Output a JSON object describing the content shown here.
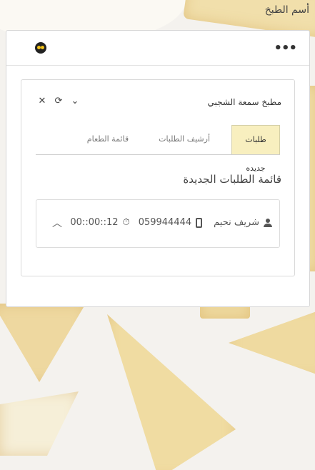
{
  "header": {
    "title": "أسم الطبخ"
  },
  "panel": {
    "menu_icon": "more-dots-icon",
    "logo_icon": "eyes-logo-icon"
  },
  "card": {
    "kitchen_name": "مطبخ سمعة الشجبي",
    "icons": [
      "close-icon",
      "refresh-icon",
      "chevron-down-icon"
    ]
  },
  "tabs": [
    {
      "label": "طلبات جديده",
      "active": true
    },
    {
      "label": "أرشيف الطلبات",
      "active": false
    },
    {
      "label": "قائمة الطعام",
      "active": false
    }
  ],
  "section": {
    "title": "قائمة الطلبات الجديدة"
  },
  "orders": [
    {
      "customer": "شريف نحيم",
      "phone": "059944444",
      "elapsed": "00::00::12"
    }
  ],
  "colors": {
    "active_tab": "#f8efbf",
    "accent": "#d59a1b"
  }
}
